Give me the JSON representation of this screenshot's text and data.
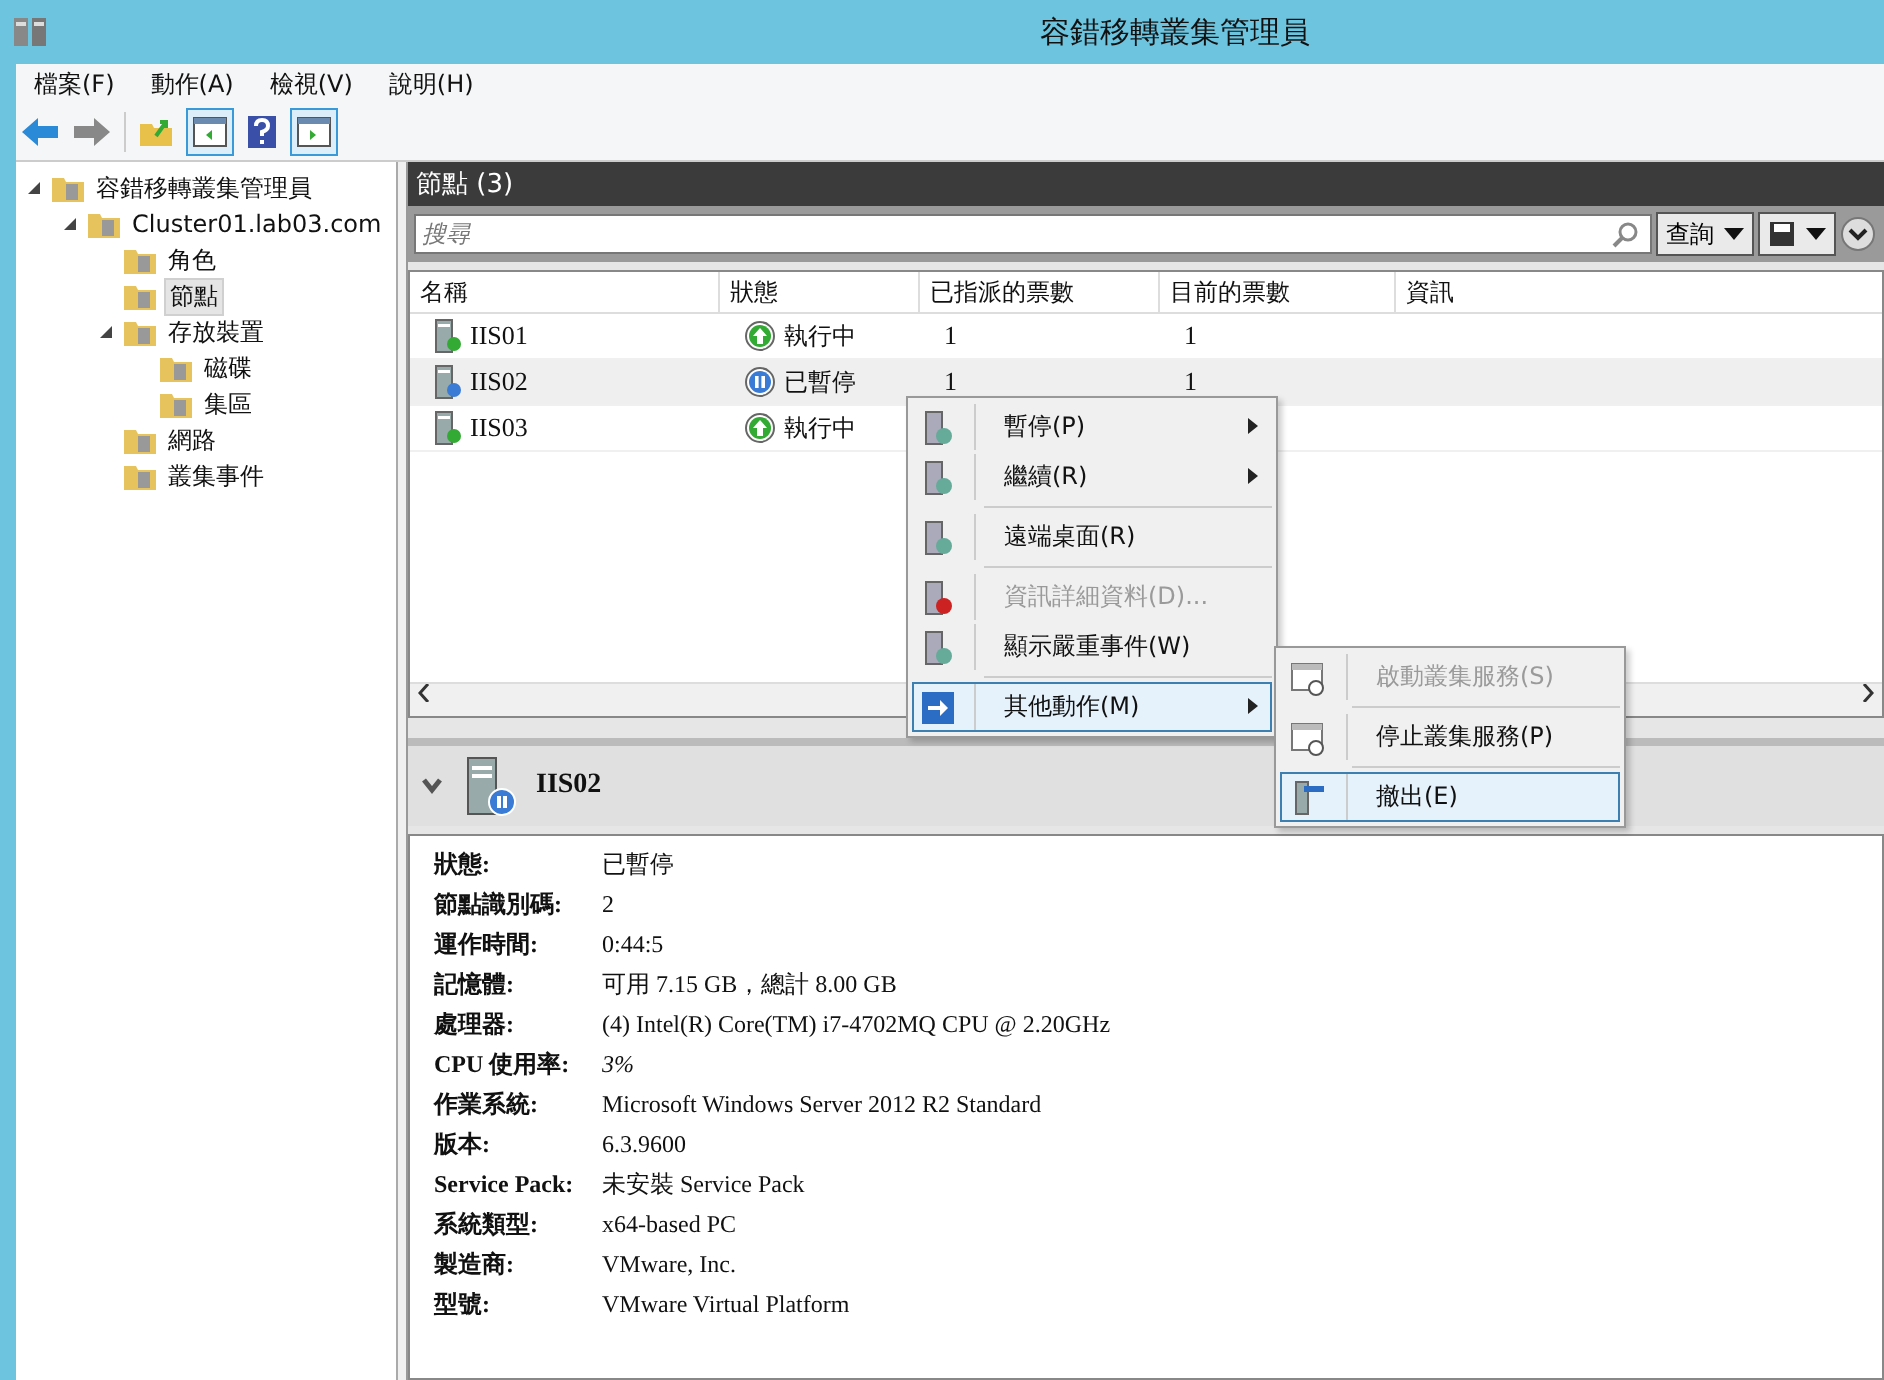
{
  "window": {
    "title": "容錯移轉叢集管理員"
  },
  "menu": [
    "檔案(F)",
    "動作(A)",
    "檢視(V)",
    "說明(H)"
  ],
  "tree": [
    {
      "label": "容錯移轉叢集管理員",
      "selected": false,
      "expanded": true,
      "children": [
        {
          "label": "Cluster01.lab03.com",
          "selected": false,
          "expanded": true,
          "children": [
            {
              "label": "角色",
              "selected": false
            },
            {
              "label": "節點",
              "selected": true
            },
            {
              "label": "存放裝置",
              "selected": false,
              "expanded": true,
              "children": [
                {
                  "label": "磁碟",
                  "selected": false
                },
                {
                  "label": "集區",
                  "selected": false
                }
              ]
            },
            {
              "label": "網路",
              "selected": false
            },
            {
              "label": "叢集事件",
              "selected": false
            }
          ]
        }
      ]
    }
  ],
  "panel": {
    "title": "節點 (3)",
    "search": {
      "placeholder": "搜尋"
    },
    "query_button": "查詢"
  },
  "table": {
    "columns": [
      "名稱",
      "狀態",
      "已指派的票數",
      "目前的票數",
      "資訊"
    ],
    "rows": [
      {
        "name": "IIS01",
        "status": "執行中",
        "kind": "running",
        "assigned": "1",
        "current": "1",
        "selected": false
      },
      {
        "name": "IIS02",
        "status": "已暫停",
        "kind": "paused",
        "assigned": "1",
        "current": "1",
        "selected": true
      },
      {
        "name": "IIS03",
        "status": "執行中",
        "kind": "running",
        "selected": false
      }
    ]
  },
  "context_menu": [
    [
      {
        "label": "暫停(P)",
        "disabled": false,
        "submenu": true,
        "selected": false
      },
      {
        "label": "繼續(R)",
        "disabled": false,
        "submenu": true,
        "selected": false
      }
    ],
    [
      {
        "label": "遠端桌面(R)",
        "disabled": false,
        "submenu": false,
        "selected": false
      }
    ],
    [
      {
        "label": "資訊詳細資料(D)...",
        "disabled": true,
        "submenu": false,
        "selected": false
      },
      {
        "label": "顯示嚴重事件(W)",
        "disabled": false,
        "submenu": false,
        "selected": false
      }
    ],
    [
      {
        "label": "其他動作(M)",
        "disabled": false,
        "submenu": true,
        "selected": true
      }
    ]
  ],
  "submenu": [
    [
      {
        "label": "啟動叢集服務(S)",
        "disabled": true,
        "selected": false
      }
    ],
    [
      {
        "label": "停止叢集服務(P)",
        "disabled": false,
        "selected": false
      }
    ],
    [
      {
        "label": "撤出(E)",
        "disabled": false,
        "selected": true
      }
    ]
  ],
  "details": {
    "name": "IIS02",
    "properties": [
      {
        "label": "狀態:",
        "value": "已暫停",
        "italic": false
      },
      {
        "label": "節點識別碼:",
        "value": "2",
        "italic": false
      },
      {
        "label": "運作時間:",
        "value": "0:44:5",
        "italic": false
      },
      {
        "label": "記憶體:",
        "value": "可用 7.15 GB，總計 8.00 GB",
        "italic": false
      },
      {
        "label": "處理器:",
        "value": "(4) Intel(R) Core(TM) i7-4702MQ CPU @ 2.20GHz",
        "italic": false
      },
      {
        "label": "CPU 使用率:",
        "value": "3%",
        "italic": true
      },
      {
        "label": "作業系統:",
        "value": "Microsoft Windows Server 2012 R2 Standard",
        "italic": false
      },
      {
        "label": "版本:",
        "value": "6.3.9600",
        "italic": false
      },
      {
        "label": "Service Pack:",
        "value": "未安裝 Service Pack",
        "italic": false
      },
      {
        "label": "系統類型:",
        "value": "x64-based PC",
        "italic": false
      },
      {
        "label": "製造商:",
        "value": "VMware, Inc.",
        "italic": false
      },
      {
        "label": "型號:",
        "value": "VMware Virtual Platform",
        "italic": false
      }
    ]
  }
}
